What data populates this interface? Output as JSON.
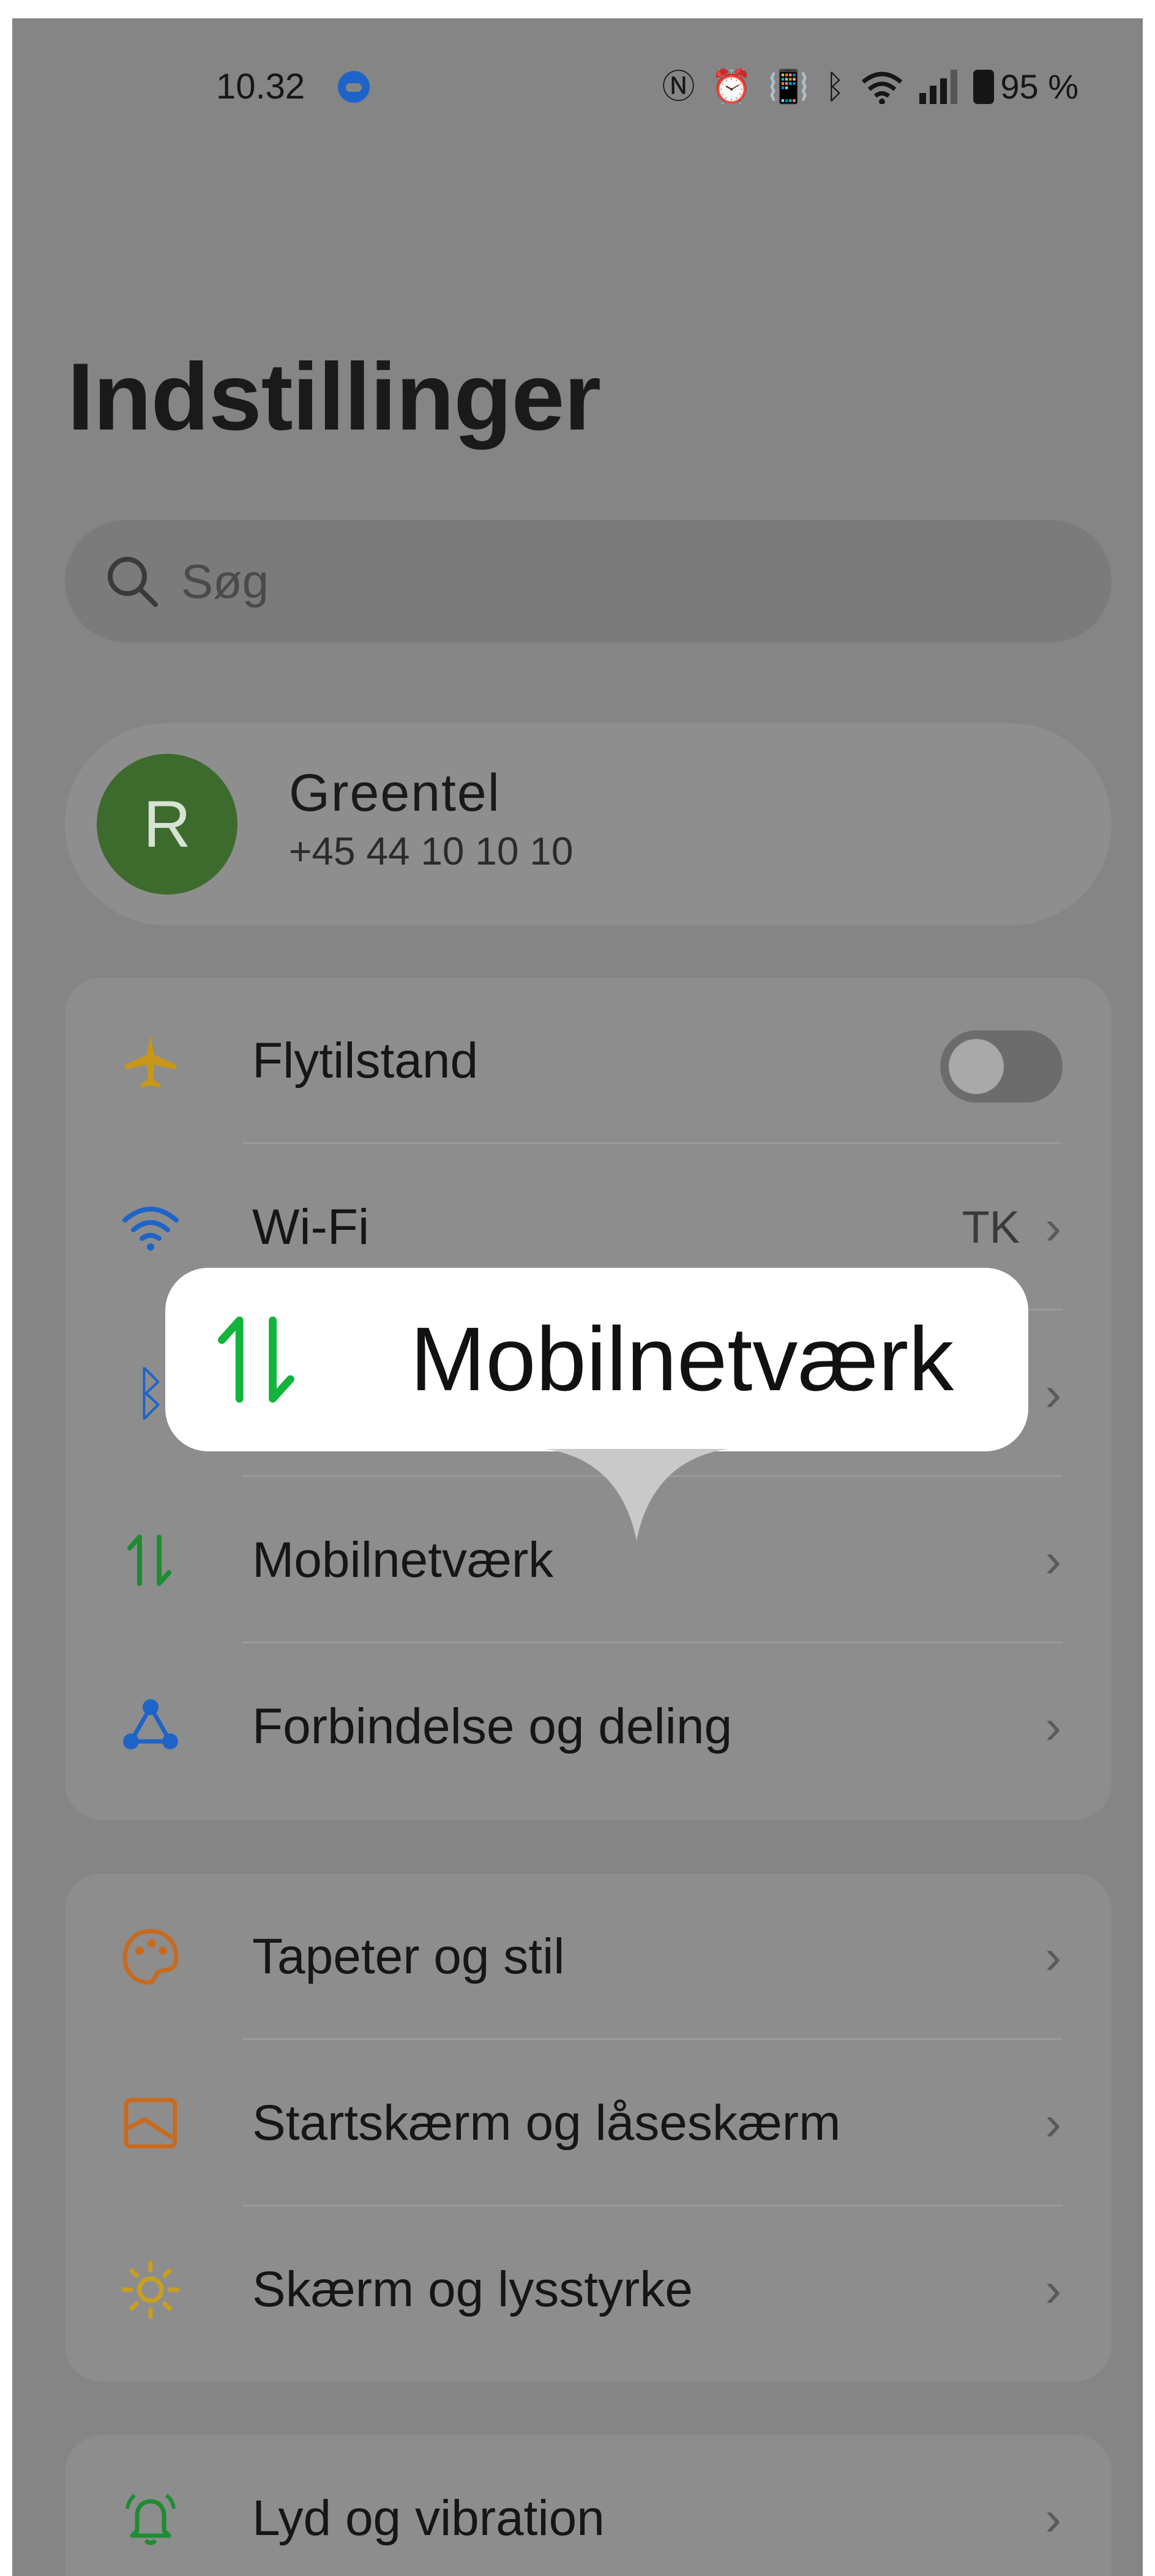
{
  "status_bar": {
    "time": "10.32",
    "battery": "95 %"
  },
  "page_title": "Indstillinger",
  "search": {
    "placeholder": "Søg"
  },
  "account": {
    "initial": "R",
    "name": "Greentel",
    "phone": "+45 44 10 10 10"
  },
  "connectivity": {
    "airplane": {
      "label": "Flytilstand",
      "icon": "airplane-icon",
      "color": "#c8961a",
      "toggle_on": false
    },
    "wifi": {
      "label": "Wi-Fi",
      "value": "TK",
      "icon": "wifi-icon",
      "color": "#1e64c8"
    },
    "mobile": {
      "label": "Mobilnetværk",
      "icon": "mobile-data-icon",
      "color": "#1e8c32"
    },
    "connection": {
      "label": "Forbindelse og deling",
      "icon": "share-connection-icon",
      "color": "#1e64c8"
    }
  },
  "personalization": {
    "wallpaper": {
      "label": "Tapeter og stil",
      "icon": "palette-icon",
      "color": "#c86a1e"
    },
    "homescreen": {
      "label": "Startskærm og låseskærm",
      "icon": "home-lock-screen-icon",
      "color": "#c86a1e"
    },
    "display": {
      "label": "Skærm og lysstyrke",
      "icon": "brightness-icon",
      "color": "#c8a01e"
    }
  },
  "sound": {
    "sound": {
      "label": "Lyd og vibration",
      "icon": "bell-icon",
      "color": "#1e8c32"
    }
  },
  "tooltip": {
    "label": "Mobilnetværk",
    "icon": "mobile-data-icon",
    "color": "#12b43c"
  }
}
